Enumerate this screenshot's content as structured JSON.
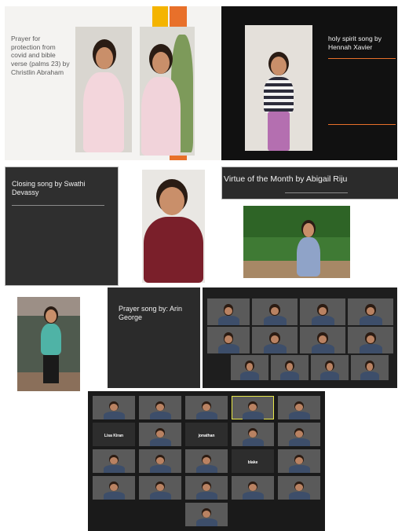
{
  "panels": {
    "prayer_protection": {
      "caption": "Prayer for protection from covid and bible verse (palms 23) by Christlin Abraham"
    },
    "holy_spirit": {
      "caption": "holy spirit song by Hennah Xavier"
    },
    "closing": {
      "caption": "Closing song by Swathi Devassy"
    },
    "virtue": {
      "caption": "Virtue of the Month by Abigail Riju"
    },
    "prayer_song": {
      "caption": "Prayer song by: Arin George"
    }
  },
  "colors": {
    "slide_dark": "#2f2f2f",
    "slide_black": "#111111",
    "accent_orange": "#e8702a",
    "accent_yellow": "#f4b400",
    "tile_active_border": "#e8e84a"
  },
  "gallery_top": {
    "tiles": [
      {
        "name": ""
      },
      {
        "name": ""
      },
      {
        "name": ""
      },
      {
        "name": ""
      },
      {
        "name": ""
      },
      {
        "name": ""
      },
      {
        "name": ""
      },
      {
        "name": ""
      },
      {
        "name": ""
      },
      {
        "name": ""
      },
      {
        "name": ""
      },
      {
        "name": ""
      },
      {
        "name": ""
      },
      {
        "name": ""
      }
    ]
  },
  "gallery_bottom": {
    "tiles": [
      {
        "label": ""
      },
      {
        "label": ""
      },
      {
        "label": ""
      },
      {
        "label": ""
      },
      {
        "label": ""
      },
      {
        "label": "Lisa Kiran"
      },
      {
        "label": ""
      },
      {
        "label": "jonathan"
      },
      {
        "label": ""
      },
      {
        "label": ""
      },
      {
        "label": ""
      },
      {
        "label": ""
      },
      {
        "label": ""
      },
      {
        "label": "blake"
      },
      {
        "label": ""
      },
      {
        "label": ""
      },
      {
        "label": ""
      },
      {
        "label": ""
      },
      {
        "label": ""
      },
      {
        "label": ""
      },
      {
        "label": ""
      }
    ]
  }
}
